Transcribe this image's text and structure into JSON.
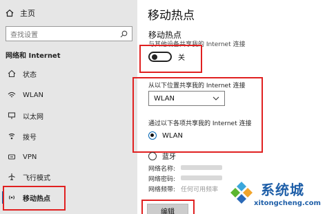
{
  "sidebar": {
    "home_label": "主页",
    "search_placeholder": "查找设置",
    "section_title": "网络和 Internet",
    "items": [
      {
        "icon": "home-icon",
        "label": "状态"
      },
      {
        "icon": "wifi-icon",
        "label": "WLAN"
      },
      {
        "icon": "ethernet-icon",
        "label": "以太网"
      },
      {
        "icon": "dialup-icon",
        "label": "拨号"
      },
      {
        "icon": "vpn-icon",
        "label": "VPN"
      },
      {
        "icon": "airplane-icon",
        "label": "飞行模式"
      },
      {
        "icon": "hotspot-icon",
        "label": "移动热点"
      }
    ],
    "active_item": "移动热点"
  },
  "main": {
    "page_title": "移动热点",
    "sub_title": "移动热点",
    "share_desc": "与其他设备共享我的 Internet 连接",
    "toggle": {
      "state_label": "关",
      "on": false
    },
    "share_from_label": "从以下位置共享我的 Internet 连接",
    "share_from_value": "WLAN",
    "share_via_label": "通过以下各项共享我的 Internet 连接",
    "options": [
      {
        "label": "WLAN",
        "checked": true
      },
      {
        "label": "蓝牙",
        "checked": false
      }
    ],
    "info": {
      "network_name_label": "网络名称:",
      "network_password_label": "网络密码:",
      "network_band_label": "网络频带:",
      "network_band_value": "任何可用频率"
    },
    "edit_button": "编辑"
  },
  "watermark": {
    "brand": "系统城",
    "url": "xitongcheng.com"
  },
  "colors": {
    "sidebar_bg": "#e6e6e6",
    "accent": "#0063b1",
    "highlight_red": "#e02020",
    "watermark_blue": "#1f5fa8"
  }
}
